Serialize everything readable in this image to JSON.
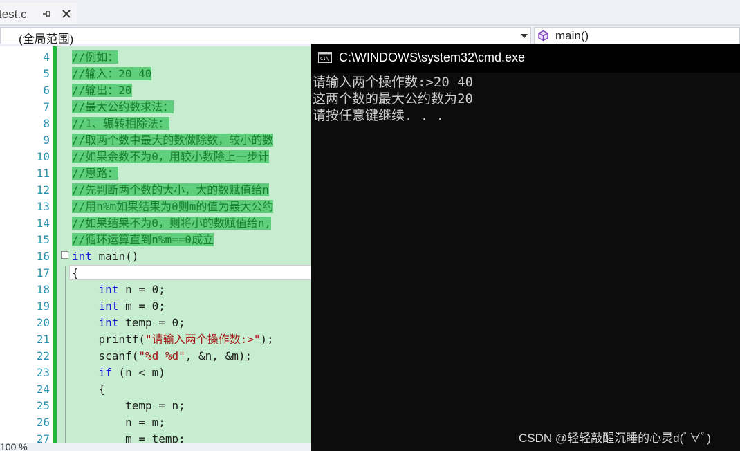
{
  "ide": {
    "tab": {
      "label": "test.c"
    },
    "nav": {
      "scope": "(全局范围)",
      "member": "main()"
    },
    "zoom": "100 %",
    "lines": [
      {
        "num": "4",
        "segments": [
          {
            "t": "//例如：",
            "c": "cmt"
          }
        ]
      },
      {
        "num": "5",
        "segments": [
          {
            "t": "//输入：20 40",
            "c": "cmt"
          }
        ]
      },
      {
        "num": "6",
        "segments": [
          {
            "t": "//输出：20",
            "c": "cmt"
          }
        ]
      },
      {
        "num": "7",
        "segments": [
          {
            "t": "//最大公约数求法：",
            "c": "cmt"
          }
        ]
      },
      {
        "num": "8",
        "segments": [
          {
            "t": "//1、辗转相除法：",
            "c": "cmt"
          }
        ]
      },
      {
        "num": "9",
        "segments": [
          {
            "t": "//取两个数中最大的数做除数，较小的数",
            "c": "cmt"
          }
        ]
      },
      {
        "num": "10",
        "segments": [
          {
            "t": "//如果余数不为0，用较小数除上一步计",
            "c": "cmt"
          }
        ]
      },
      {
        "num": "11",
        "segments": [
          {
            "t": "//思路：",
            "c": "cmt"
          }
        ]
      },
      {
        "num": "12",
        "segments": [
          {
            "t": "//先判断两个数的大小，大的数赋值给n",
            "c": "cmt"
          }
        ]
      },
      {
        "num": "13",
        "segments": [
          {
            "t": "//用n%m如果结果为0则m的值为最大公约",
            "c": "cmt"
          }
        ]
      },
      {
        "num": "14",
        "segments": [
          {
            "t": "//如果结果不为0，则将小的数赋值给n,",
            "c": "cmt"
          }
        ]
      },
      {
        "num": "15",
        "segments": [
          {
            "t": "//循环运算直到n%m==0成立",
            "c": "cmt"
          }
        ]
      },
      {
        "num": "16",
        "segments": [
          {
            "t": "int",
            "c": "kw"
          },
          {
            "t": " main()",
            "c": ""
          }
        ]
      },
      {
        "num": "17",
        "segments": [
          {
            "t": "{",
            "c": ""
          }
        ]
      },
      {
        "num": "18",
        "segments": [
          {
            "t": "    ",
            "c": ""
          },
          {
            "t": "int",
            "c": "kw"
          },
          {
            "t": " n = 0;",
            "c": ""
          }
        ]
      },
      {
        "num": "19",
        "segments": [
          {
            "t": "    ",
            "c": ""
          },
          {
            "t": "int",
            "c": "kw"
          },
          {
            "t": " m = 0;",
            "c": ""
          }
        ]
      },
      {
        "num": "20",
        "segments": [
          {
            "t": "    ",
            "c": ""
          },
          {
            "t": "int",
            "c": "kw"
          },
          {
            "t": " temp = 0;",
            "c": ""
          }
        ]
      },
      {
        "num": "21",
        "segments": [
          {
            "t": "    printf(",
            "c": ""
          },
          {
            "t": "\"请输入两个操作数:>\"",
            "c": "str"
          },
          {
            "t": ");",
            "c": ""
          }
        ]
      },
      {
        "num": "22",
        "segments": [
          {
            "t": "    scanf(",
            "c": ""
          },
          {
            "t": "\"%d %d\"",
            "c": "str"
          },
          {
            "t": ", &n, &m);",
            "c": ""
          }
        ]
      },
      {
        "num": "23",
        "segments": [
          {
            "t": "    ",
            "c": ""
          },
          {
            "t": "if",
            "c": "kw"
          },
          {
            "t": " (n < m)",
            "c": ""
          }
        ]
      },
      {
        "num": "24",
        "segments": [
          {
            "t": "    {",
            "c": ""
          }
        ]
      },
      {
        "num": "25",
        "segments": [
          {
            "t": "        temp = n;",
            "c": ""
          }
        ]
      },
      {
        "num": "26",
        "segments": [
          {
            "t": "        n = m;",
            "c": ""
          }
        ]
      },
      {
        "num": "27",
        "segments": [
          {
            "t": "        m = temp;",
            "c": ""
          }
        ]
      }
    ]
  },
  "cmd": {
    "title": "C:\\WINDOWS\\system32\\cmd.exe",
    "output": [
      "请输入两个操作数:>20 40",
      "这两个数的最大公约数为20",
      "请按任意键继续. . ."
    ]
  },
  "watermark": "CSDN @轻轻敲醒沉睡的心灵d(ﾟ∀ﾟ)"
}
